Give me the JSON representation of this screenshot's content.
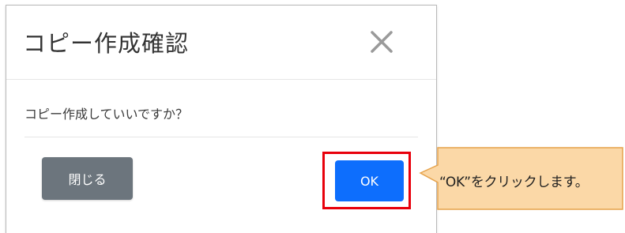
{
  "dialog": {
    "title": "コピー作成確認",
    "close_icon": "close-icon",
    "message": "コピー作成していいですか？",
    "buttons": {
      "close_label": "閉じる",
      "ok_label": "OK"
    }
  },
  "annotation": {
    "callout_text": "“OK”をクリックします。",
    "highlight_color": "#e8000b",
    "callout_fill": "#fbd8a7",
    "callout_border": "#e6a34c"
  },
  "colors": {
    "ok_button": "#0d6efd",
    "close_button": "#6c757d"
  }
}
